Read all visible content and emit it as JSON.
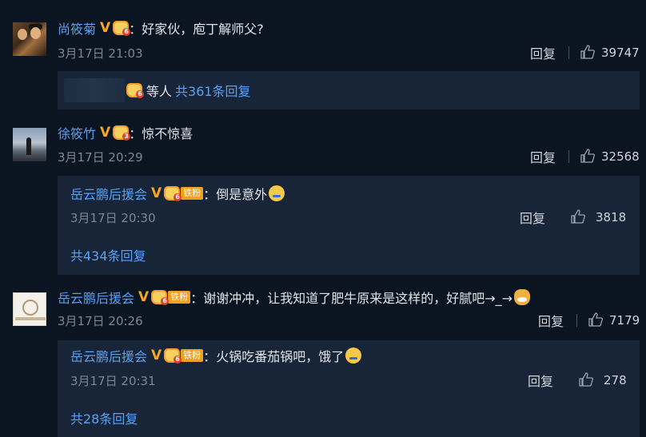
{
  "comments": [
    {
      "user": "尚筱菊",
      "text": "好家伙，庖丁解师父?",
      "time": "3月17日 21:03",
      "reply_label": "回复",
      "likes": "39747",
      "more_prefix": "等人",
      "more_link": "共361条回复"
    },
    {
      "user": "徐筱竹",
      "text": "惊不惊喜",
      "time": "3月17日 20:29",
      "reply_label": "回复",
      "likes": "32568",
      "sub": {
        "user": "岳云鹏后援会",
        "fan_badge": "铁粉",
        "text": "倒是意外",
        "time": "3月17日 20:30",
        "reply_label": "回复",
        "likes": "3818",
        "more_link": "共434条回复"
      }
    },
    {
      "user": "岳云鹏后援会",
      "fan_badge": "铁粉",
      "text": "谢谢冲冲，让我知道了肥牛原来是这样的，好腻吧→_→",
      "time": "3月17日 20:26",
      "reply_label": "回复",
      "likes": "7179",
      "sub": {
        "user": "岳云鹏后援会",
        "fan_badge": "铁粉",
        "text": "火锅吃番茄锅吧，饿了",
        "time": "3月17日 20:31",
        "reply_label": "回复",
        "likes": "278",
        "more_link": "共28条回复"
      }
    }
  ],
  "icons": {
    "verified": "verified-v-icon",
    "crown": "vip-crown-icon",
    "like": "thumbs-up-icon"
  },
  "colors": {
    "background": "#0b1421",
    "panel": "#182538",
    "link": "#5aa0f2",
    "verified": "#f5a623"
  }
}
